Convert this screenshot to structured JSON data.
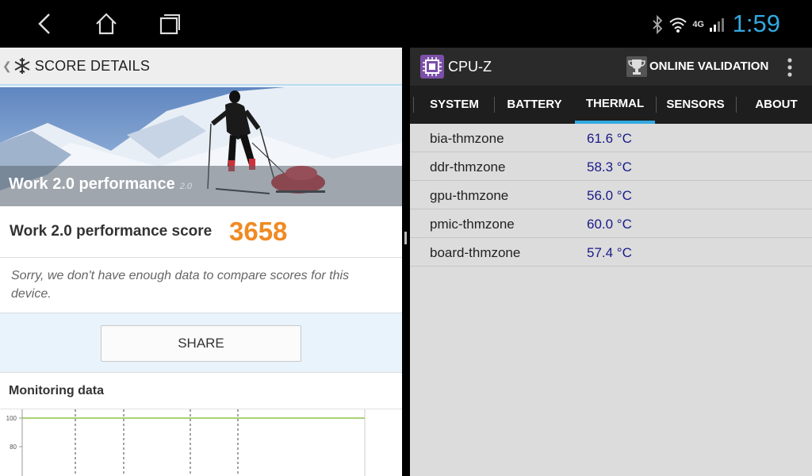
{
  "status_bar": {
    "network": "4G",
    "time": "1:59",
    "colors": {
      "clock": "#33a8e0"
    }
  },
  "left_app": {
    "header_title": "SCORE DETAILS",
    "hero": {
      "title": "Work 2.0 performance",
      "version": "2.0"
    },
    "score": {
      "label": "Work 2.0 performance score",
      "value": "3658",
      "color": "#f08a24"
    },
    "note": "Sorry, we don't have enough data to compare scores for this device.",
    "share_label": "SHARE",
    "monitoring": {
      "title": "Monitoring data",
      "ticks": [
        "100",
        "80"
      ],
      "series_value": 100,
      "series_color": "#8bc34a"
    }
  },
  "right_app": {
    "app_name": "CPU-Z",
    "validation_label": "ONLINE VALIDATION",
    "tabs": [
      {
        "label": "SYSTEM",
        "active": false
      },
      {
        "label": "BATTERY",
        "active": false
      },
      {
        "label": "THERMAL",
        "active": true
      },
      {
        "label": "SENSORS",
        "active": false
      },
      {
        "label": "ABOUT",
        "active": false
      }
    ],
    "thermal": [
      {
        "zone": "bia-thmzone",
        "temp": "61.6 °C"
      },
      {
        "zone": "ddr-thmzone",
        "temp": "58.3 °C"
      },
      {
        "zone": "gpu-thmzone",
        "temp": "56.0 °C"
      },
      {
        "zone": "pmic-thmzone",
        "temp": "60.0 °C"
      },
      {
        "zone": "board-thmzone",
        "temp": "57.4 °C"
      }
    ],
    "accent_color": "#33a8e0"
  }
}
